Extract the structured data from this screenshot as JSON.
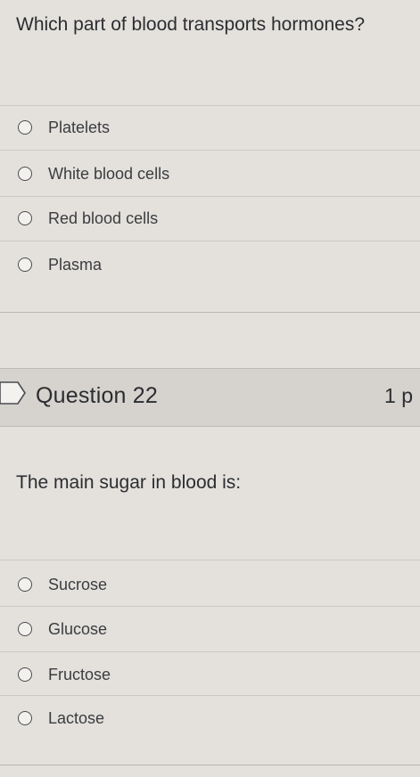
{
  "question_21": {
    "prompt": "Which part of blood transports hormones?",
    "options": [
      "Platelets",
      "White blood cells",
      "Red blood cells",
      "Plasma"
    ]
  },
  "question_22": {
    "title": "Question 22",
    "points": "1 p",
    "prompt": "The main sugar in blood is:",
    "options": [
      "Sucrose",
      "Glucose",
      "Fructose",
      "Lactose"
    ]
  }
}
